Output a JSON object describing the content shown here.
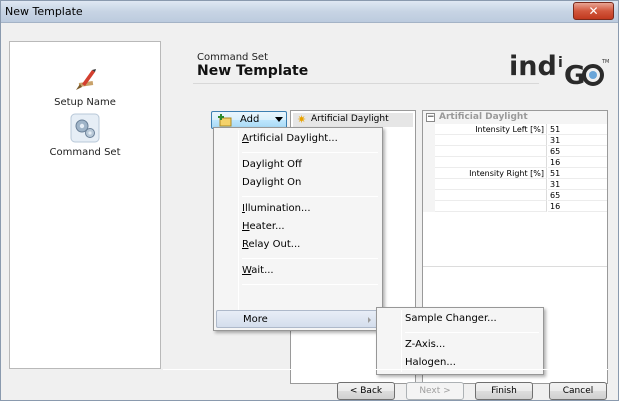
{
  "window": {
    "title": "New Template",
    "close_glyph": "✕"
  },
  "nav": {
    "items": [
      {
        "label": "Setup Name",
        "icon": "pen-icon"
      },
      {
        "label": "Command Set",
        "icon": "gears-icon"
      }
    ]
  },
  "header": {
    "subtitle": "Command Set",
    "title": "New Template",
    "logo_main": "indiGo",
    "logo_tm": "TM"
  },
  "add_button": {
    "label": "Add"
  },
  "command_list": {
    "items": [
      "Artificial Daylight"
    ]
  },
  "property_grid": {
    "group": "Artificial Daylight",
    "rows": [
      {
        "name": "Intensity Left [%]",
        "value": "51"
      },
      {
        "name": "",
        "value": "31"
      },
      {
        "name": "",
        "value": "65"
      },
      {
        "name": "",
        "value": "16"
      },
      {
        "name": "Intensity Right [%]",
        "value": "51"
      },
      {
        "name": "",
        "value": "31"
      },
      {
        "name": "",
        "value": "65"
      },
      {
        "name": "",
        "value": "16"
      }
    ]
  },
  "menu": {
    "artificial_daylight_u": "A",
    "artificial_daylight_rest": "rtificial Daylight...",
    "daylight_off": "Daylight Off",
    "daylight_on": "Daylight On",
    "illumination_u": "I",
    "illumination_rest": "llumination...",
    "heater_u": "H",
    "heater_rest": "eater...",
    "relay_u": "R",
    "relay_rest": "elay Out...",
    "wait_u": "W",
    "wait_rest": "ait...",
    "more": "More"
  },
  "submenu": {
    "sample_changer": "Sample Changer...",
    "z_axis": "Z-Axis...",
    "halogen": "Halogen..."
  },
  "buttons": {
    "back": "< Back",
    "next": "Next >",
    "finish": "Finish",
    "cancel": "Cancel"
  },
  "colors": {
    "accent": "#3c7fb1",
    "close": "#c0391f",
    "logo_o": "#6aa5d8"
  }
}
